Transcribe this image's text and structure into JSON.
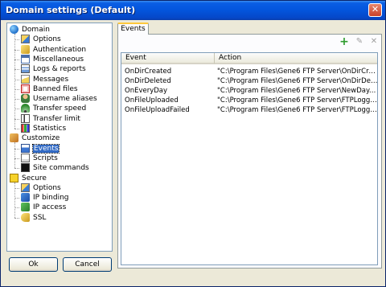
{
  "window": {
    "title": "Domain settings (Default)",
    "close_glyph": "✕"
  },
  "tree": {
    "groups": [
      {
        "label": "Domain",
        "icon": "globe-icon",
        "items": [
          {
            "label": "Options",
            "icon": "options-icon"
          },
          {
            "label": "Authentication",
            "icon": "key-icon"
          },
          {
            "label": "Miscellaneous",
            "icon": "misc-icon"
          },
          {
            "label": "Logs & reports",
            "icon": "logs-icon"
          },
          {
            "label": "Messages",
            "icon": "messages-icon"
          },
          {
            "label": "Banned files",
            "icon": "banned-files-icon"
          },
          {
            "label": "Username aliases",
            "icon": "user-alias-icon"
          },
          {
            "label": "Transfer speed",
            "icon": "speed-gauge-icon"
          },
          {
            "label": "Transfer limit",
            "icon": "transfer-limit-icon"
          },
          {
            "label": "Statistics",
            "icon": "statistics-icon"
          }
        ]
      },
      {
        "label": "Customize",
        "icon": "customize-icon",
        "items": [
          {
            "label": "Events",
            "icon": "events-icon",
            "selected": true
          },
          {
            "label": "Scripts",
            "icon": "scripts-icon"
          },
          {
            "label": "Site commands",
            "icon": "console-icon"
          }
        ]
      },
      {
        "label": "Secure",
        "icon": "secure-icon",
        "items": [
          {
            "label": "Options",
            "icon": "options-icon"
          },
          {
            "label": "IP binding",
            "icon": "ip-binding-icon"
          },
          {
            "label": "IP access",
            "icon": "ip-access-icon"
          },
          {
            "label": "SSL",
            "icon": "ssl-key-icon"
          }
        ]
      }
    ]
  },
  "buttons": {
    "ok": "Ok",
    "cancel": "Cancel"
  },
  "tab": {
    "label": "Events"
  },
  "toolbar": {
    "add_glyph": "+",
    "edit_glyph": "✎",
    "delete_glyph": "✕"
  },
  "events_table": {
    "columns": [
      "Event",
      "Action"
    ],
    "rows": [
      {
        "event": "OnDirCreated",
        "action": "\"C:\\Program Files\\Gene6 FTP Server\\OnDirCreated...."
      },
      {
        "event": "OnDirDeleted",
        "action": "\"C:\\Program Files\\Gene6 FTP Server\\OnDirDeleted...."
      },
      {
        "event": "OnEveryDay",
        "action": "\"C:\\Program Files\\Gene6 FTP Server\\NewDay.exe\""
      },
      {
        "event": "OnFileUploaded",
        "action": "\"C:\\Program Files\\Gene6 FTP Server\\FTPLogger.exe..."
      },
      {
        "event": "OnFileUploadFailed",
        "action": "\"C:\\Program Files\\Gene6 FTP Server\\FTPLogger.exe..."
      }
    ]
  },
  "colors": {
    "titlebar": "#0355dc",
    "selection": "#316ac5",
    "add_green": "#2e9b2e",
    "disabled_gray": "#a0a0a0"
  }
}
